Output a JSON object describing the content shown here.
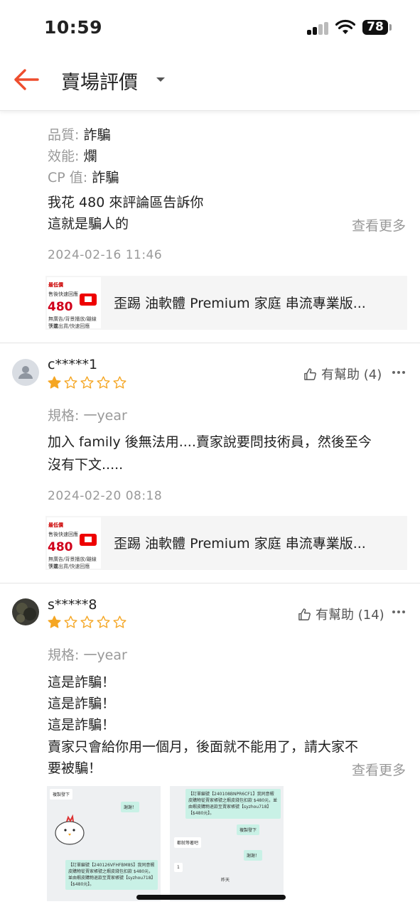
{
  "status": {
    "time": "10:59",
    "battery": "78"
  },
  "header": {
    "title": "賣場評價",
    "back_icon": "arrow-left-icon",
    "accent": "#ee4d2d"
  },
  "review1": {
    "attrs": [
      {
        "label": "品質: ",
        "value": "詐騙"
      },
      {
        "label": "效能: ",
        "value": "爛"
      },
      {
        "label": "CP 值: ",
        "value": "詐騙"
      }
    ],
    "lines": [
      "我花 480 來評論區告訴你",
      "這就是騙人的"
    ],
    "more": "查看更多",
    "date": "2024-02-16 11:46"
  },
  "product": {
    "name": "歪踢 油軟體 Premium 家庭 串流專業版...",
    "thumb": {
      "badge": "最低價",
      "line2": "售後快速回應",
      "price": "480",
      "line3": "無廣告/背景播放/離線下載",
      "line4": "快速出貨/快速回應"
    }
  },
  "review2": {
    "user": "c*****1",
    "rating": 1,
    "max_rating": 5,
    "helpful": "有幫助 (4)",
    "spec": "規格: 一year",
    "lines": [
      "加入 family 後無法用....賣家說要問技術員，然後至今",
      "沒有下文....."
    ],
    "date": "2024-02-20 08:18"
  },
  "review3": {
    "user": "s*****8",
    "rating": 1,
    "max_rating": 5,
    "helpful": "有幫助 (14)",
    "spec": "規格: 一year",
    "lines": [
      "這是詐騙！",
      "這是詐騙！",
      "這是詐騙！",
      "賣家只會給你用一個月，後面就不能用了，請大家不",
      "要被騙！"
    ],
    "more": "查看更多",
    "images": [
      {
        "copy": "複製發下",
        "thanks": "謝謝！",
        "order": "【訂單編號【240126VFHFBM8S】我同意蝦皮購物從賣家帳號之蝦皮錢包扣款 $480元，並由蝦皮購物退款至賣家帳號【syzhou718】【$480元】。"
      },
      {
        "order": "【訂單編號【240108BNPR6CF1】我同意蝦皮購物從賣家帳號之蝦皮錢包扣款 $480元，並由蝦皮購物退款至賣家帳號【syzhou718】【$480元】。",
        "copy": "複製發下",
        "wait": "都就等著吧",
        "thanks": "謝謝！",
        "num": "1",
        "yesterday": "昨天"
      }
    ]
  },
  "colors": {
    "star": "#f5a623",
    "muted": "#999999",
    "text": "#222222"
  }
}
